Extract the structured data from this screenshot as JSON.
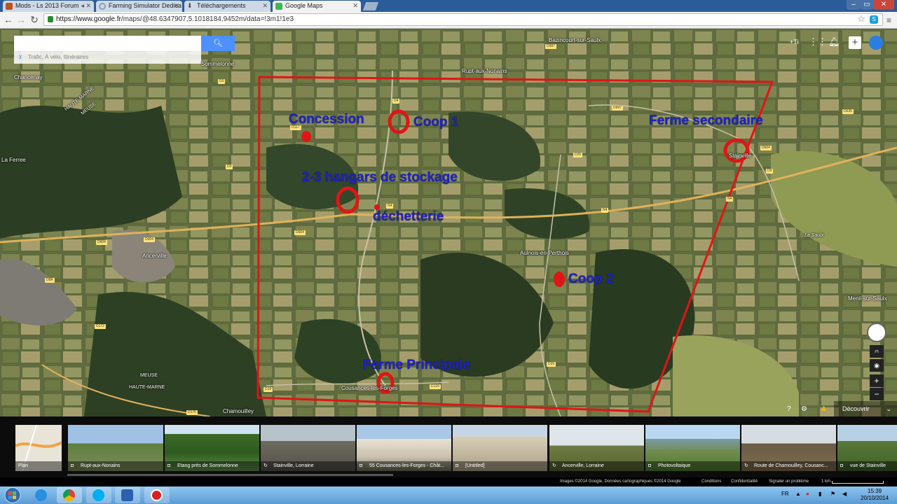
{
  "browser": {
    "tabs": [
      {
        "label": "Mods - Ls 2013 Forum",
        "favicon": "ls-forum-icon",
        "color": "#c05020"
      },
      {
        "label": "Farming Simulator Dedica",
        "favicon": "loading-icon",
        "color": "#8aa0b8"
      },
      {
        "label": "Téléchargements",
        "favicon": "download-icon",
        "color": "#666666"
      },
      {
        "label": "Google Maps",
        "favicon": "google-maps-icon",
        "color": "#3cba54"
      }
    ],
    "url_host": "https://www.google.fr",
    "url_path": "/maps/@48.6347907,5.1018184,9452m/data=!3m1!1e3",
    "window_controls": [
      "–",
      "▭",
      "✕"
    ]
  },
  "maps": {
    "search_placeholder": "",
    "search_hint": "Trafic, À vélo, Itinéraires",
    "user_label": "+Ti",
    "place_labels": [
      "Bazincourt-sur-Saulx",
      "Sommelonne",
      "Chancenay",
      "Rupt-aux-Nonains",
      "HAUTE-MARNE",
      "MEUSE",
      "La Ferree",
      "Ancerville",
      "Aulnois-en-Perthois",
      "Stainville",
      "Menil-sur-Saulx",
      "MEUSE",
      "HAUTE-MARNE",
      "Cousances-les-Forges",
      "Chamouilley",
      "La Saulx"
    ],
    "road_labels": [
      "D997",
      "D3",
      "D4",
      "D117",
      "D997",
      "D635",
      "D604",
      "D9",
      "D25",
      "N4",
      "N4",
      "D604",
      "D604",
      "D604",
      "D8A",
      "D172",
      "D19",
      "D129",
      "D176",
      "D3",
      "D25",
      "N4"
    ],
    "annotations": {
      "concession": "Concession",
      "coop1": "Coop 1",
      "ferme_secondaire": "Ferme secondaire",
      "hangars": "2-3 hangars de stockage",
      "dechetterie": "déchetterie",
      "coop2": "Coop 2",
      "ferme_principale": "Ferme Principale"
    },
    "decouvrir_label": "Découvrir",
    "zoom_plus": "+",
    "zoom_minus": "−"
  },
  "photo_strip": [
    {
      "caption": "Plan",
      "kind": "map"
    },
    {
      "caption": "Rupt-aux-Nonains",
      "kind": "photo"
    },
    {
      "caption": "Etang près de Sommelonne",
      "kind": "photo"
    },
    {
      "caption": "Stainville, Lorraine",
      "kind": "360"
    },
    {
      "caption": "55 Cousances-les-Forges - Chât...",
      "kind": "photo"
    },
    {
      "caption": "[Untitled]",
      "kind": "photo"
    },
    {
      "caption": "Ancerville, Lorraine",
      "kind": "360"
    },
    {
      "caption": "Photovoltaique",
      "kind": "photo"
    },
    {
      "caption": "Route de Chamouilley, Cousanc...",
      "kind": "360"
    },
    {
      "caption": "vue de Stainville",
      "kind": "photo"
    }
  ],
  "attribution": {
    "imagery": "Images ©2014 Google, Données cartographiques ©2014 Google",
    "conditions": "Conditions",
    "privacy": "Confidentialité",
    "report": "Signaler un problème",
    "scale": "1 km"
  },
  "taskbar": {
    "language": "FR",
    "time": "15:39",
    "date": "20/10/2014",
    "apps": [
      "internet-explorer-icon",
      "chrome-icon",
      "skype-icon",
      "app-icon",
      "record-icon"
    ]
  }
}
